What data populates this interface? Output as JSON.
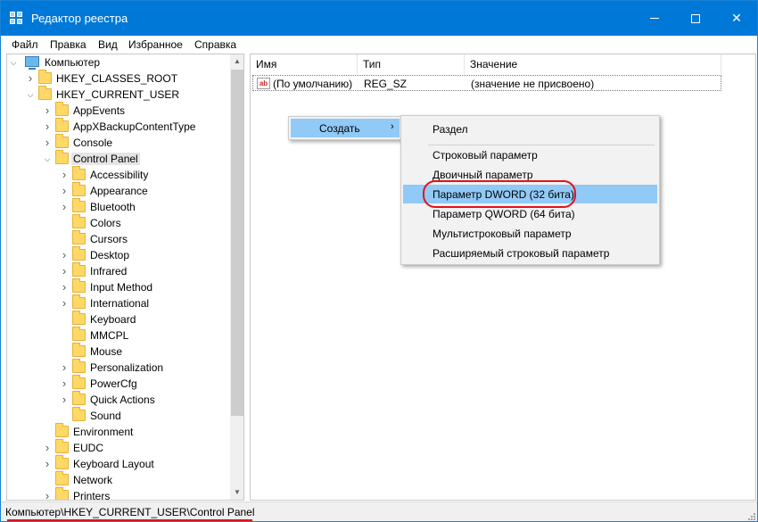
{
  "window": {
    "title": "Редактор реестра"
  },
  "colors": {
    "titlebar": "#0078d7",
    "highlight": "#91c9f7",
    "annotation_red": "#e3121b",
    "folder": "#ffd866"
  },
  "menu": [
    "Файл",
    "Правка",
    "Вид",
    "Избранное",
    "Справка"
  ],
  "tree": {
    "root": "Компьютер",
    "items": [
      {
        "label": "HKEY_CLASSES_ROOT",
        "level": 1,
        "expand": "collapsed"
      },
      {
        "label": "HKEY_CURRENT_USER",
        "level": 1,
        "expand": "expanded"
      },
      {
        "label": "AppEvents",
        "level": 2,
        "expand": "collapsed"
      },
      {
        "label": "AppXBackupContentType",
        "level": 2,
        "expand": "collapsed"
      },
      {
        "label": "Console",
        "level": 2,
        "expand": "collapsed"
      },
      {
        "label": "Control Panel",
        "level": 2,
        "expand": "expanded",
        "selected": true
      },
      {
        "label": "Accessibility",
        "level": 3,
        "expand": "collapsed"
      },
      {
        "label": "Appearance",
        "level": 3,
        "expand": "collapsed"
      },
      {
        "label": "Bluetooth",
        "level": 3,
        "expand": "collapsed"
      },
      {
        "label": "Colors",
        "level": 3,
        "expand": "none"
      },
      {
        "label": "Cursors",
        "level": 3,
        "expand": "none"
      },
      {
        "label": "Desktop",
        "level": 3,
        "expand": "collapsed"
      },
      {
        "label": "Infrared",
        "level": 3,
        "expand": "collapsed"
      },
      {
        "label": "Input Method",
        "level": 3,
        "expand": "collapsed"
      },
      {
        "label": "International",
        "level": 3,
        "expand": "collapsed"
      },
      {
        "label": "Keyboard",
        "level": 3,
        "expand": "none"
      },
      {
        "label": "MMCPL",
        "level": 3,
        "expand": "none"
      },
      {
        "label": "Mouse",
        "level": 3,
        "expand": "none"
      },
      {
        "label": "Personalization",
        "level": 3,
        "expand": "collapsed"
      },
      {
        "label": "PowerCfg",
        "level": 3,
        "expand": "collapsed"
      },
      {
        "label": "Quick Actions",
        "level": 3,
        "expand": "collapsed"
      },
      {
        "label": "Sound",
        "level": 3,
        "expand": "none"
      },
      {
        "label": "Environment",
        "level": 2,
        "expand": "none"
      },
      {
        "label": "EUDC",
        "level": 2,
        "expand": "collapsed"
      },
      {
        "label": "Keyboard Layout",
        "level": 2,
        "expand": "collapsed"
      },
      {
        "label": "Network",
        "level": 2,
        "expand": "none"
      },
      {
        "label": "Printers",
        "level": 2,
        "expand": "collapsed"
      }
    ]
  },
  "list": {
    "columns": [
      "Имя",
      "Тип",
      "Значение"
    ],
    "rows": [
      {
        "icon": "ab",
        "name": "(По умолчанию)",
        "type": "REG_SZ",
        "value": "(значение не присвоено)"
      }
    ]
  },
  "context_menu": {
    "create_label": "Создать",
    "submenu": [
      "Раздел",
      "Строковый параметр",
      "Двоичный параметр",
      "Параметр DWORD (32 бита)",
      "Параметр QWORD (64 бита)",
      "Мультистроковый параметр",
      "Расширяемый строковый параметр"
    ],
    "highlighted_item": "Параметр DWORD (32 бита)"
  },
  "statusbar": {
    "path": "Компьютер\\HKEY_CURRENT_USER\\Control Panel"
  }
}
